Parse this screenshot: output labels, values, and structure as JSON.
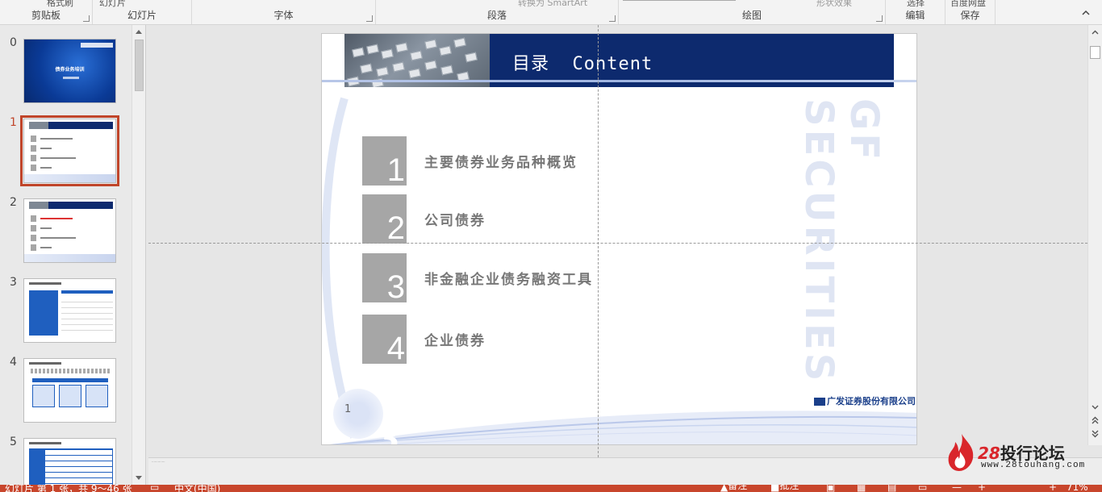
{
  "ribbon": {
    "groups": [
      {
        "label": "剪贴板"
      },
      {
        "label": "幻灯片"
      },
      {
        "label": "字体"
      },
      {
        "label": "段落"
      },
      {
        "label": "绘图"
      },
      {
        "label": "编辑"
      },
      {
        "label": "保存"
      }
    ],
    "cut_texts": {
      "paste_format": "格式刷",
      "new_slide": "幻灯片",
      "convert": "转换为 SmartArt",
      "shape_effects": "形状效果",
      "select": "选择",
      "baidu": "百度网盘"
    }
  },
  "thumbnails": {
    "items": [
      {
        "number": "0",
        "selected": false
      },
      {
        "number": "1",
        "selected": true
      },
      {
        "number": "2",
        "selected": false
      },
      {
        "number": "3",
        "selected": false
      },
      {
        "number": "4",
        "selected": false
      },
      {
        "number": "5",
        "selected": false
      }
    ],
    "thumb0_title": "债券业务培训"
  },
  "slide": {
    "title": "目录  Content",
    "toc": [
      {
        "number": "1",
        "text": "主要债券业务品种概览"
      },
      {
        "number": "2",
        "text": "公司债券"
      },
      {
        "number": "3",
        "text": "非金融企业债务融资工具"
      },
      {
        "number": "4",
        "text": "企业债券"
      }
    ],
    "watermark": "GF SECURITIES",
    "slide_number": "1",
    "logo_text": "广发证券股份有限公司",
    "ghost_digit": "3"
  },
  "status": {
    "slide_info": "幻灯片 第 1 张，共 9～46 张",
    "language": "中文(中国)",
    "notes": "备注",
    "comments": "批注",
    "zoom": "71%"
  },
  "brand": {
    "number": "28",
    "name": "投行论坛",
    "url": "www.28touhang.com"
  },
  "colors": {
    "accent": "#c0452a",
    "banner": "#0d2a6e",
    "toc_box": "#a6a6a6"
  }
}
